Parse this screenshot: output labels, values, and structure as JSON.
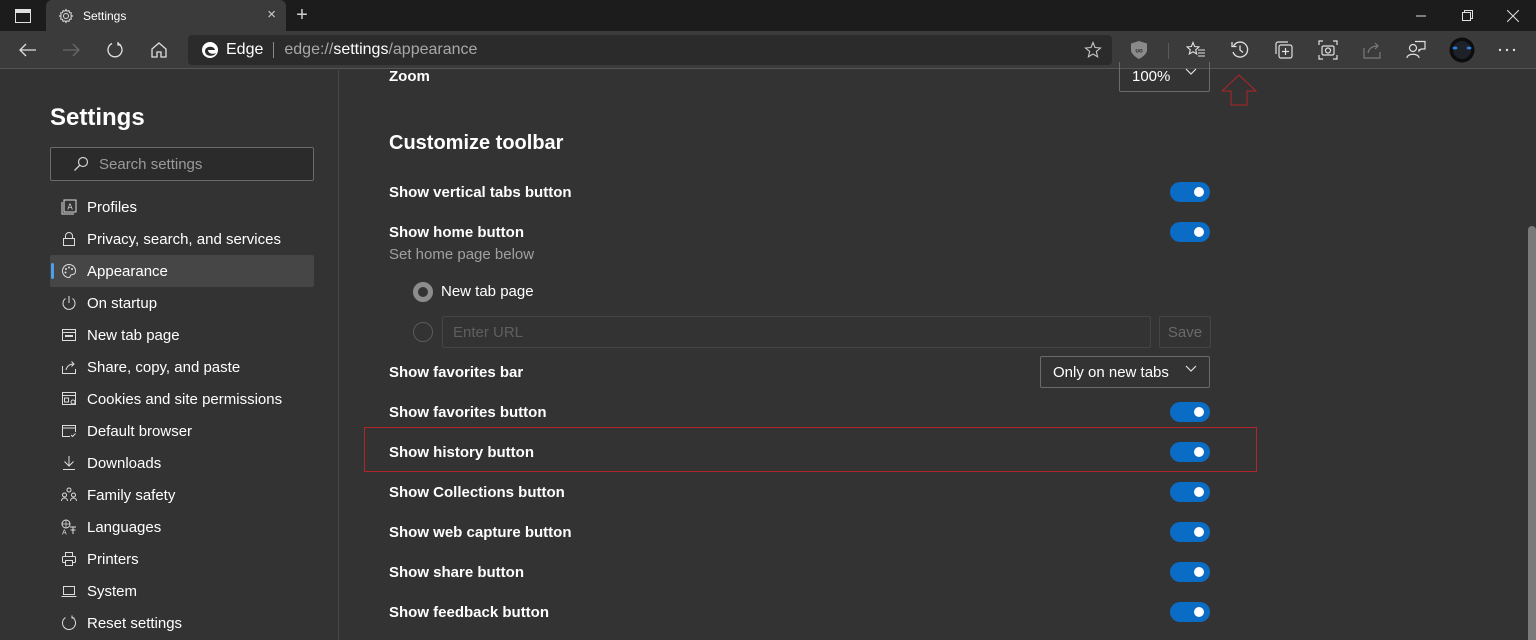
{
  "window": {
    "tab_title": "Settings",
    "tab_close": "×",
    "new_tab": "+",
    "controls": [
      "minimize",
      "restore",
      "close"
    ]
  },
  "toolbar": {
    "browser_name": "Edge",
    "url_prefix": "edge://",
    "url_bold": "settings",
    "url_suffix": "/appearance",
    "icons": [
      "back-icon",
      "forward-icon",
      "refresh-icon",
      "home-icon",
      "add-favorite-icon",
      "ublock-extension-icon",
      "favorites-icon",
      "history-icon",
      "collections-icon",
      "web-capture-icon",
      "share-icon",
      "feedback-icon",
      "profile-avatar",
      "more-icon"
    ]
  },
  "sidebar": {
    "title": "Settings",
    "search_placeholder": "Search settings",
    "items": [
      {
        "label": "Profiles",
        "icon": "profile-icon",
        "active": false
      },
      {
        "label": "Privacy, search, and services",
        "icon": "lock-icon",
        "active": false
      },
      {
        "label": "Appearance",
        "icon": "palette-icon",
        "active": true
      },
      {
        "label": "On startup",
        "icon": "power-icon",
        "active": false
      },
      {
        "label": "New tab page",
        "icon": "newtab-icon",
        "active": false
      },
      {
        "label": "Share, copy, and paste",
        "icon": "share-icon",
        "active": false
      },
      {
        "label": "Cookies and site permissions",
        "icon": "cookies-icon",
        "active": false
      },
      {
        "label": "Default browser",
        "icon": "default-browser-icon",
        "active": false
      },
      {
        "label": "Downloads",
        "icon": "download-icon",
        "active": false
      },
      {
        "label": "Family safety",
        "icon": "family-icon",
        "active": false
      },
      {
        "label": "Languages",
        "icon": "languages-icon",
        "active": false
      },
      {
        "label": "Printers",
        "icon": "printer-icon",
        "active": false
      },
      {
        "label": "System",
        "icon": "laptop-icon",
        "active": false
      },
      {
        "label": "Reset settings",
        "icon": "reset-icon",
        "active": false
      }
    ]
  },
  "main": {
    "zoom_label": "Zoom",
    "zoom_value": "100%",
    "section_title": "Customize toolbar",
    "vertical_tabs": {
      "label": "Show vertical tabs button",
      "on": true
    },
    "home": {
      "label": "Show home button",
      "sub": "Set home page below",
      "on": true
    },
    "home_options": {
      "new_tab_label": "New tab page",
      "url_placeholder": "Enter URL",
      "save_label": "Save",
      "selected": "New tab page"
    },
    "favorites_bar": {
      "label": "Show favorites bar",
      "value": "Only on new tabs"
    },
    "toggles": [
      {
        "label": "Show favorites button",
        "on": true
      },
      {
        "label": "Show history button",
        "on": true,
        "highlighted": true
      },
      {
        "label": "Show Collections button",
        "on": true
      },
      {
        "label": "Show web capture button",
        "on": true
      },
      {
        "label": "Show share button",
        "on": true
      },
      {
        "label": "Show feedback button",
        "on": true
      }
    ]
  },
  "colors": {
    "accent": "#0a6cc4",
    "annotation": "#b0242a",
    "background": "#333333"
  }
}
